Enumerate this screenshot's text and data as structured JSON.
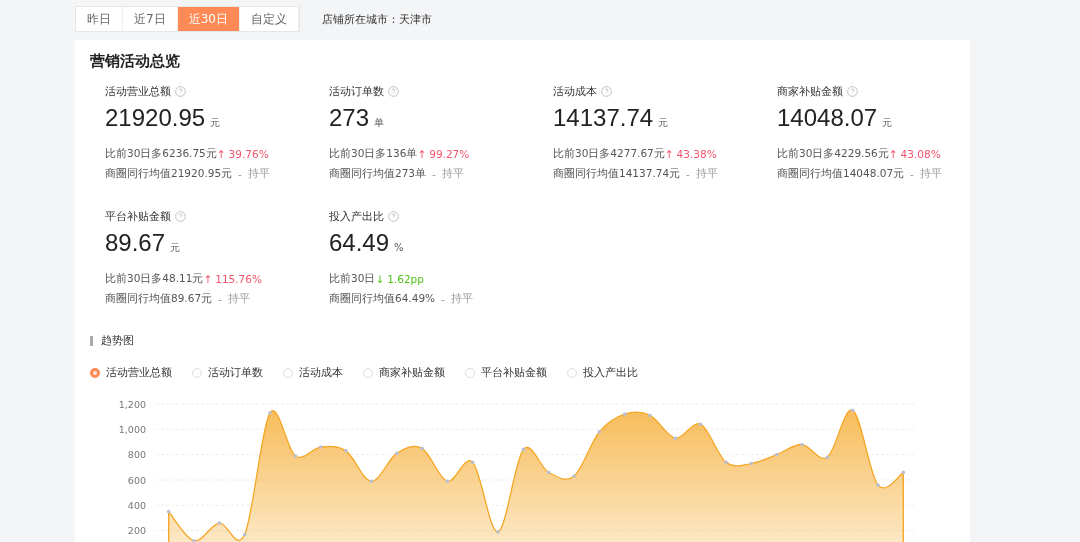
{
  "period_tabs": [
    {
      "label": "昨日",
      "selected": false
    },
    {
      "label": "近7日",
      "selected": false
    },
    {
      "label": "近30日",
      "selected": true
    },
    {
      "label": "自定义",
      "selected": false
    }
  ],
  "store_city": "店铺所在城市：天津市",
  "overview": {
    "title": "营销活动总览",
    "metrics": [
      {
        "label": "活动营业总额",
        "value": "21920.95",
        "unit": "元",
        "compare": "比前30日多6236.75元",
        "color": "#f2546b",
        "arrow": "↑",
        "change": "39.76%",
        "peer": "商圈同行均值21920.95元",
        "separator": "-",
        "peer_status": "持平"
      },
      {
        "label": "活动订单数",
        "value": "273",
        "unit": "单",
        "compare": "比前30日多136单",
        "color": "#f2546b",
        "arrow": "↑",
        "change": "99.27%",
        "peer": "商圈同行均值273单",
        "separator": "-",
        "peer_status": "持平"
      },
      {
        "label": "活动成本",
        "value": "14137.74",
        "unit": "元",
        "compare": "比前30日多4277.67元",
        "color": "#f2546b",
        "arrow": "↑",
        "change": "43.38%",
        "peer": "商圈同行均值14137.74元",
        "separator": "-",
        "peer_status": "持平"
      },
      {
        "label": "商家补贴金额",
        "value": "14048.07",
        "unit": "元",
        "compare": "比前30日多4229.56元",
        "color": "#f2546b",
        "arrow": "↑",
        "change": "43.08%",
        "peer": "商圈同行均值14048.07元",
        "separator": "-",
        "peer_status": "持平"
      },
      {
        "label": "平台补贴金额",
        "value": "89.67",
        "unit": "元",
        "compare": "比前30日多48.11元",
        "color": "#f2546b",
        "arrow": "↑",
        "change": "115.76%",
        "peer": "商圈同行均值89.67元",
        "separator": "-",
        "peer_status": "持平"
      },
      {
        "label": "投入产出比",
        "value": "64.49",
        "unit": "%",
        "compare": "比前30日",
        "color": "#52c41a",
        "arrow": "↓",
        "change": "1.62pp",
        "peer": "商圈同行均值64.49%",
        "separator": "-",
        "peer_status": "持平"
      }
    ]
  },
  "trend": {
    "title": "趋势图",
    "options": [
      {
        "label": "活动营业总额",
        "selected": true
      },
      {
        "label": "活动订单数",
        "selected": false
      },
      {
        "label": "活动成本",
        "selected": false
      },
      {
        "label": "商家补贴金额",
        "selected": false
      },
      {
        "label": "平台补贴金额",
        "selected": false
      },
      {
        "label": "投入产出比",
        "selected": false
      }
    ],
    "chart_data": {
      "type": "area",
      "grid": true,
      "ylim": [
        0,
        1200
      ],
      "yticks": [
        {
          "value": 200,
          "label": "200"
        },
        {
          "value": 400,
          "label": "400"
        },
        {
          "value": 600,
          "label": "600"
        },
        {
          "value": 800,
          "label": "800"
        },
        {
          "value": 1000,
          "label": "1,000"
        },
        {
          "value": 1200,
          "label": "1,200"
        }
      ],
      "series": [
        {
          "color": "#f5a623",
          "values": [
            350,
            120,
            260,
            170,
            1130,
            790,
            860,
            830,
            590,
            810,
            850,
            590,
            740,
            190,
            840,
            660,
            630,
            980,
            1120,
            1110,
            930,
            1040,
            740,
            730,
            800,
            880,
            780,
            1150,
            560,
            660
          ]
        }
      ]
    }
  }
}
